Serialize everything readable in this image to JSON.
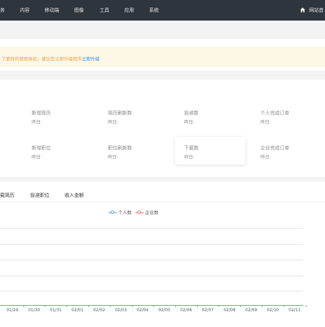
{
  "topbar": {
    "nav": [
      "务",
      "内容",
      "移动端",
      "图像",
      "工具",
      "应用",
      "系统"
    ],
    "site_label": "网站首"
  },
  "notice": {
    "text": "了更好的使用体验，建议您立即升级程序",
    "link": "立即升级"
  },
  "stats": [
    {
      "title": "新增简历",
      "sub": "昨日:"
    },
    {
      "title": "简历刷新数",
      "sub": "昨日:"
    },
    {
      "title": "投递数",
      "sub": "昨日:"
    },
    {
      "title": "个人完成订单",
      "sub": "昨日:"
    },
    {
      "title": "新增职位",
      "sub": "昨日:"
    },
    {
      "title": "职位刷新数",
      "sub": "昨日:"
    },
    {
      "title": "下载数",
      "sub": "昨日:"
    },
    {
      "title": "企业完成订单",
      "sub": "昨日:"
    }
  ],
  "tabs": [
    "载简历",
    "投递职位",
    "收入金额"
  ],
  "chart_data": {
    "type": "line",
    "x": [
      "01/29",
      "01/30",
      "01/31",
      "02/01",
      "02/02",
      "02/03",
      "02/04",
      "02/05",
      "02/06",
      "02/07",
      "02/08",
      "02/09",
      "02/10",
      "02/11"
    ],
    "series": [
      {
        "name": "个人数",
        "values": [
          0,
          0,
          0,
          0,
          0,
          0,
          0,
          0,
          0,
          0,
          0,
          0,
          0,
          0
        ],
        "color": "#5b9bd5"
      },
      {
        "name": "企业数",
        "values": [
          0,
          0,
          0,
          0,
          0,
          0,
          0,
          0,
          0,
          0,
          0,
          0,
          0,
          0
        ],
        "color": "#e07070"
      }
    ],
    "grid": true,
    "legend": "top-center"
  }
}
